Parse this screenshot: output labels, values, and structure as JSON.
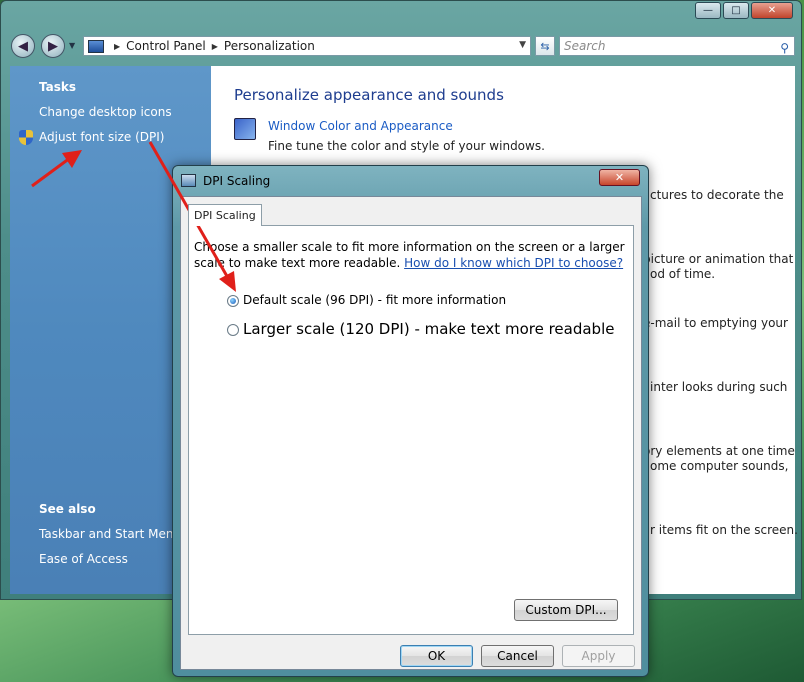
{
  "window": {
    "caption_buttons": [
      "minimize",
      "maximize",
      "close"
    ]
  },
  "navigation": {
    "breadcrumb": [
      "Control Panel",
      "Personalization"
    ],
    "search_placeholder": "Search"
  },
  "left_pane": {
    "tasks_header": "Tasks",
    "tasks": [
      "Change desktop icons",
      "Adjust font size (DPI)"
    ],
    "see_also_header": "See also",
    "see_also": [
      "Taskbar and Start Menu",
      "Ease of Access"
    ]
  },
  "main": {
    "title": "Personalize appearance and sounds",
    "items": [
      {
        "link": "Window Color and Appearance",
        "description": "Fine tune the color and style of your windows."
      }
    ],
    "obscured_fragments": [
      "ctures to decorate the",
      "picture or animation that",
      "od of time.",
      "e-mail to emptying your",
      "inter looks during such",
      "ory elements at one time",
      "ome computer sounds,",
      "r items fit on the screen."
    ]
  },
  "dialog": {
    "title": "DPI Scaling",
    "tab": "DPI Scaling",
    "description": "Choose a smaller scale to fit more information on the screen or a larger scale to make text more readable.",
    "help_link": "How do I know which DPI to choose?",
    "options": [
      {
        "label": "Default scale (96 DPI) - fit more information",
        "selected": true
      },
      {
        "label": "Larger scale (120 DPI) - make text more readable",
        "selected": false
      }
    ],
    "custom_button": "Custom DPI...",
    "ok_button": "OK",
    "cancel_button": "Cancel",
    "apply_button": "Apply"
  },
  "colors": {
    "annotation_arrow": "#e0201a",
    "link": "#1a5bc4",
    "left_pane": "#4f89be"
  }
}
